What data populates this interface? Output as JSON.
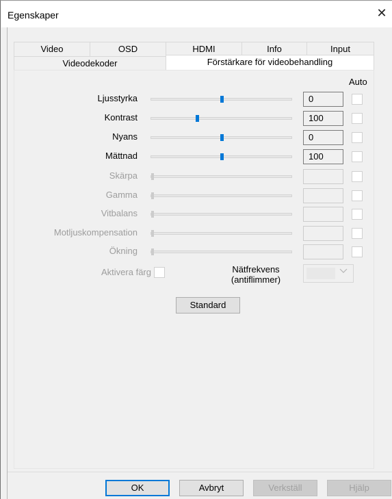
{
  "window": {
    "title": "Egenskaper",
    "close_glyph": "✕"
  },
  "tabs_top": [
    {
      "label": "Video"
    },
    {
      "label": "OSD"
    },
    {
      "label": "HDMI"
    },
    {
      "label": "Info"
    },
    {
      "label": "Input"
    }
  ],
  "tabs_bottom": [
    {
      "label": "Videodekoder"
    },
    {
      "label": "Förstärkare för videobehandling",
      "active": true
    }
  ],
  "auto_label": "Auto",
  "sliders": [
    {
      "label": "Ljusstyrka",
      "value": "0",
      "level": 0.5,
      "enabled": true
    },
    {
      "label": "Kontrast",
      "value": "100",
      "level": 0.33,
      "enabled": true
    },
    {
      "label": "Nyans",
      "value": "0",
      "level": 0.5,
      "enabled": true
    },
    {
      "label": "Mättnad",
      "value": "100",
      "level": 0.5,
      "enabled": true
    },
    {
      "label": "Skärpa",
      "value": "",
      "level": 0,
      "enabled": false
    },
    {
      "label": "Gamma",
      "value": "",
      "level": 0,
      "enabled": false
    },
    {
      "label": "Vitbalans",
      "value": "",
      "level": 0,
      "enabled": false
    },
    {
      "label": "Motljuskompensation",
      "value": "",
      "level": 0,
      "enabled": false
    },
    {
      "label": "Ökning",
      "value": "",
      "level": 0,
      "enabled": false
    }
  ],
  "color_enable": {
    "label": "Aktivera färg"
  },
  "powerline": {
    "label_line1": "Nätfrekvens",
    "label_line2": "(antiflimmer)"
  },
  "standard_button": "Standard",
  "footer": {
    "ok": "OK",
    "cancel": "Avbryt",
    "apply": "Verkställ",
    "help": "Hjälp"
  }
}
